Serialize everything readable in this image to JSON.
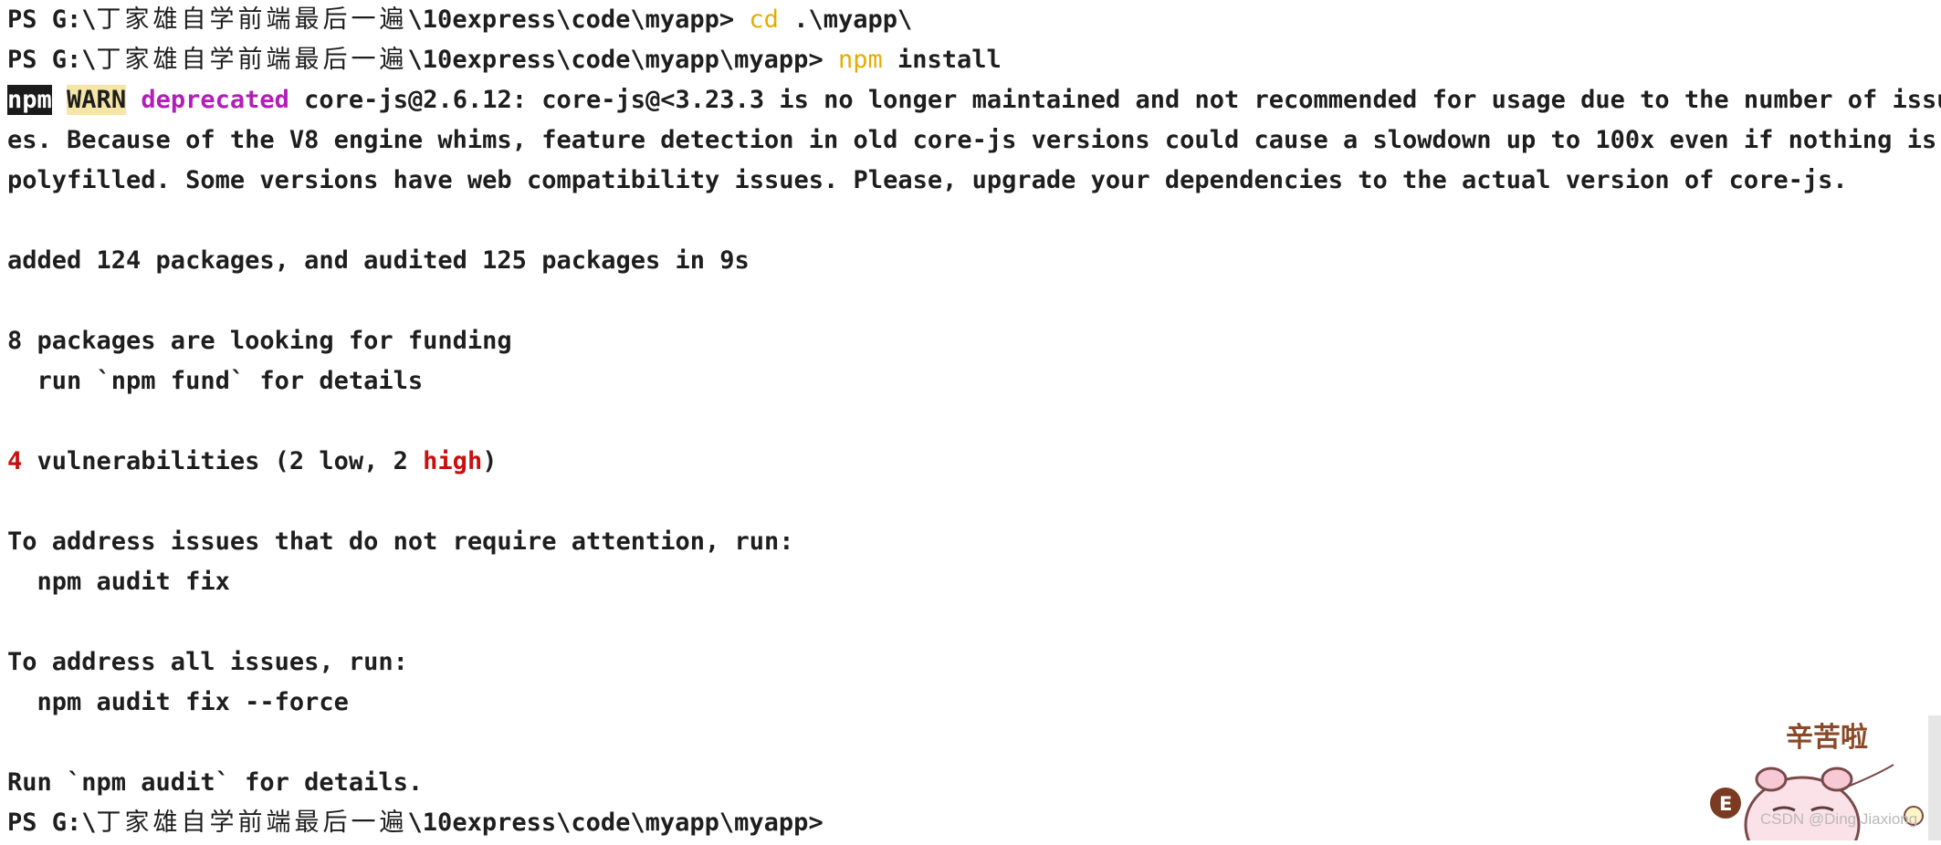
{
  "terminal": {
    "line1": {
      "prompt": "PS G:\\",
      "cjk": "丁家雄自学前端最后一遍",
      "path": "\\10express\\code\\myapp> ",
      "cmd": "cd",
      "args": " .\\myapp\\"
    },
    "line2": {
      "prompt": "PS G:\\",
      "cjk": "丁家雄自学前端最后一遍",
      "path": "\\10express\\code\\myapp\\myapp> ",
      "cmd": "npm",
      "args": " install"
    },
    "warn": {
      "npm_label": "npm",
      "warn_label": "WARN",
      "deprecated_label": "deprecated",
      "text1": " core-js@2.6.12: core-js@<3.23.3 is no longer maintained and not recommended for usage due to the number of issu",
      "text2": "es. Because of the V8 engine whims, feature detection in old core-js versions could cause a slowdown up to 100x even if nothing is",
      "text3": "polyfilled. Some versions have web compatibility issues. Please, upgrade your dependencies to the actual version of core-js."
    },
    "added": "added 124 packages, and audited 125 packages in 9s",
    "funding": "8 packages are looking for funding",
    "fund_hint": "  run `npm fund` for details",
    "vuln": {
      "count": "4",
      "text_a": " vulnerabilities (2 low, 2 ",
      "high": "high",
      "text_b": ")"
    },
    "address1": "To address issues that do not require attention, run:",
    "fix1": "  npm audit fix",
    "address2": "To address all issues, run:",
    "fix2": "  npm audit fix --force",
    "run_audit": "Run `npm audit` for details.",
    "final_prompt": {
      "prompt": "PS G:\\",
      "cjk": "丁家雄自学前端最后一遍",
      "path": "\\10express\\code\\myapp\\myapp>"
    }
  },
  "sticker": {
    "caption": "辛苦啦",
    "badge": "E",
    "icon": "cartoon-pig-icon"
  },
  "watermark": "CSDN @Ding Jiaxiong",
  "colors": {
    "command": "#e5ad00",
    "deprecated": "#b21fb8",
    "error": "#c91010",
    "warn_bg": "#f5e6a8",
    "npm_bg": "#1b1b1b"
  }
}
